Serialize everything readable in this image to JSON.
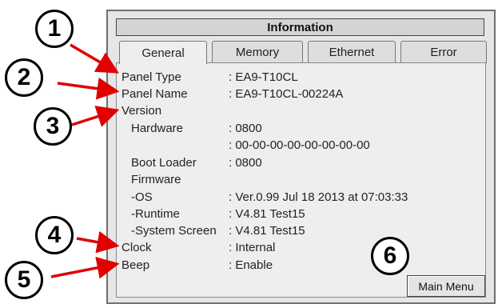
{
  "window": {
    "title": "Information",
    "tabs": [
      {
        "label": "General",
        "active": true
      },
      {
        "label": "Memory",
        "active": false
      },
      {
        "label": "Ethernet",
        "active": false
      },
      {
        "label": "Error",
        "active": false
      }
    ],
    "rows": [
      {
        "label": "Panel Type",
        "value": ": EA9-T10CL"
      },
      {
        "label": "Panel Name",
        "value": ": EA9-T10CL-00224A"
      },
      {
        "label": "Version",
        "value": ""
      },
      {
        "label": "Hardware",
        "value": ": 0800"
      },
      {
        "label": "",
        "value": ": 00-00-00-00-00-00-00-00"
      },
      {
        "label": "Boot Loader",
        "value": ": 0800"
      },
      {
        "label": "Firmware",
        "value": ""
      },
      {
        "label": "-OS",
        "value": ": Ver.0.99 Jul 18 2013 at 07:03:33"
      },
      {
        "label": "-Runtime",
        "value": ": V4.81 Test15"
      },
      {
        "label": "-System Screen",
        "value": ": V4.81 Test15"
      },
      {
        "label": "Clock",
        "value": ": Internal"
      },
      {
        "label": "Beep",
        "value": ": Enable"
      }
    ],
    "main_menu_label": "Main Menu"
  },
  "callouts": [
    "1",
    "2",
    "3",
    "4",
    "5",
    "6"
  ],
  "colors": {
    "arrow": "#e00000",
    "background": "#e6e6e6"
  }
}
